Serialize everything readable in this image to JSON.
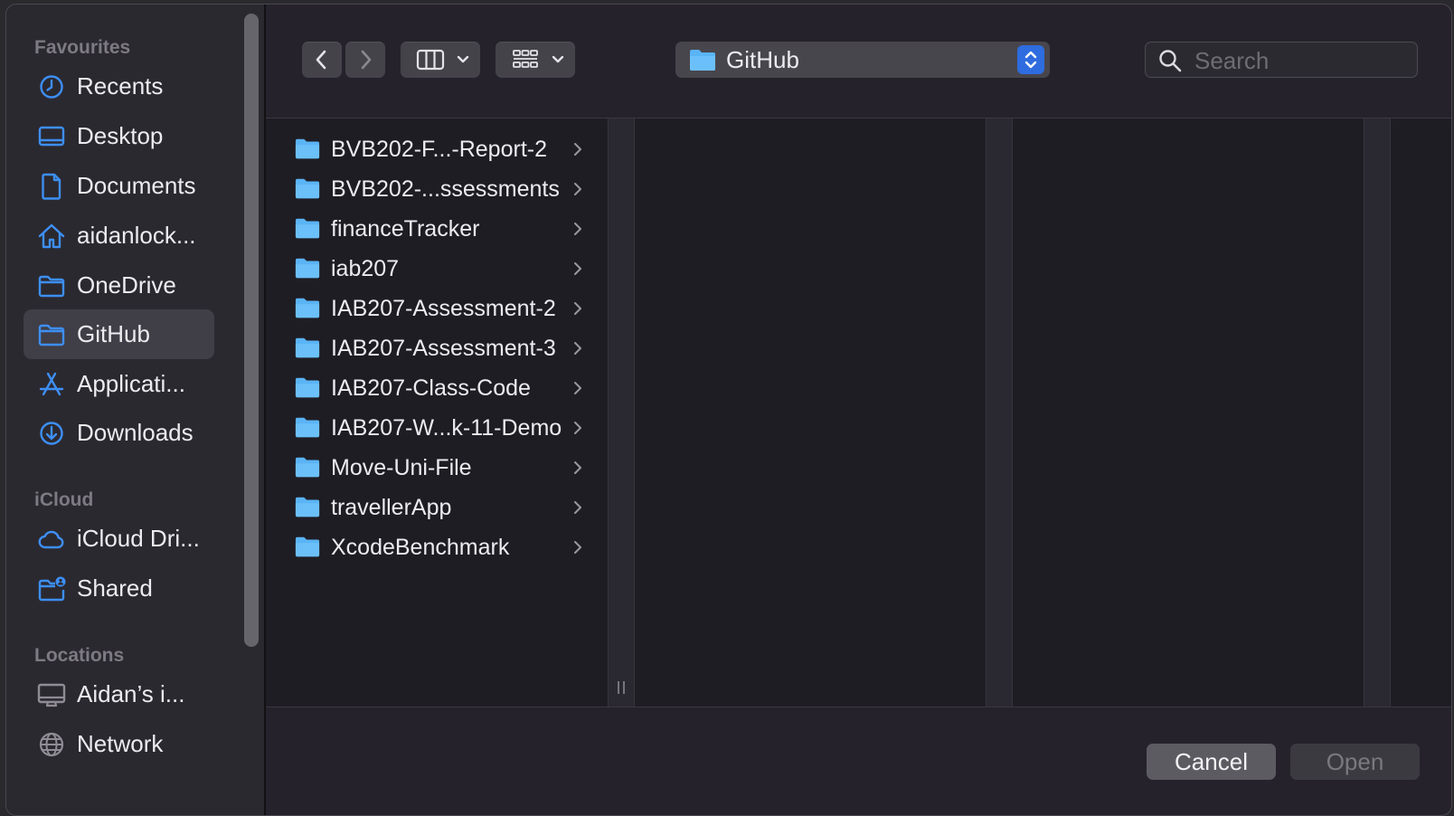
{
  "sidebar": {
    "favourites_heading": "Favourites",
    "icloud_heading": "iCloud",
    "locations_heading": "Locations",
    "favourites": [
      {
        "label": "Recents",
        "icon": "clock-icon"
      },
      {
        "label": "Desktop",
        "icon": "desktop-icon"
      },
      {
        "label": "Documents",
        "icon": "document-icon"
      },
      {
        "label": "aidanlock...",
        "icon": "home-icon"
      },
      {
        "label": "OneDrive",
        "icon": "folder-icon"
      },
      {
        "label": "GitHub",
        "icon": "folder-icon",
        "selected": true
      },
      {
        "label": "Applicati...",
        "icon": "applications-icon"
      },
      {
        "label": "Downloads",
        "icon": "download-icon"
      }
    ],
    "icloud": [
      {
        "label": "iCloud Dri...",
        "icon": "cloud-icon"
      },
      {
        "label": "Shared",
        "icon": "shared-folder-icon"
      }
    ],
    "locations": [
      {
        "label": "Aidan’s i...",
        "icon": "computer-icon"
      },
      {
        "label": "Network",
        "icon": "globe-icon"
      }
    ]
  },
  "toolbar": {
    "current_folder": "GitHub",
    "search_placeholder": "Search"
  },
  "files": [
    "BVB202-F...-Report-2",
    "BVB202-...ssessments",
    "financeTracker",
    "iab207",
    "IAB207-Assessment-2",
    "IAB207-Assessment-3",
    "IAB207-Class-Code",
    "IAB207-W...k-11-Demo",
    "Move-Uni-File",
    "travellerApp",
    "XcodeBenchmark"
  ],
  "footer": {
    "cancel_label": "Cancel",
    "open_label": "Open"
  },
  "colors": {
    "accent": "#2e6cdf",
    "icon_blue": "#3d8ff5",
    "folder_blue": "#5ab4f5"
  }
}
